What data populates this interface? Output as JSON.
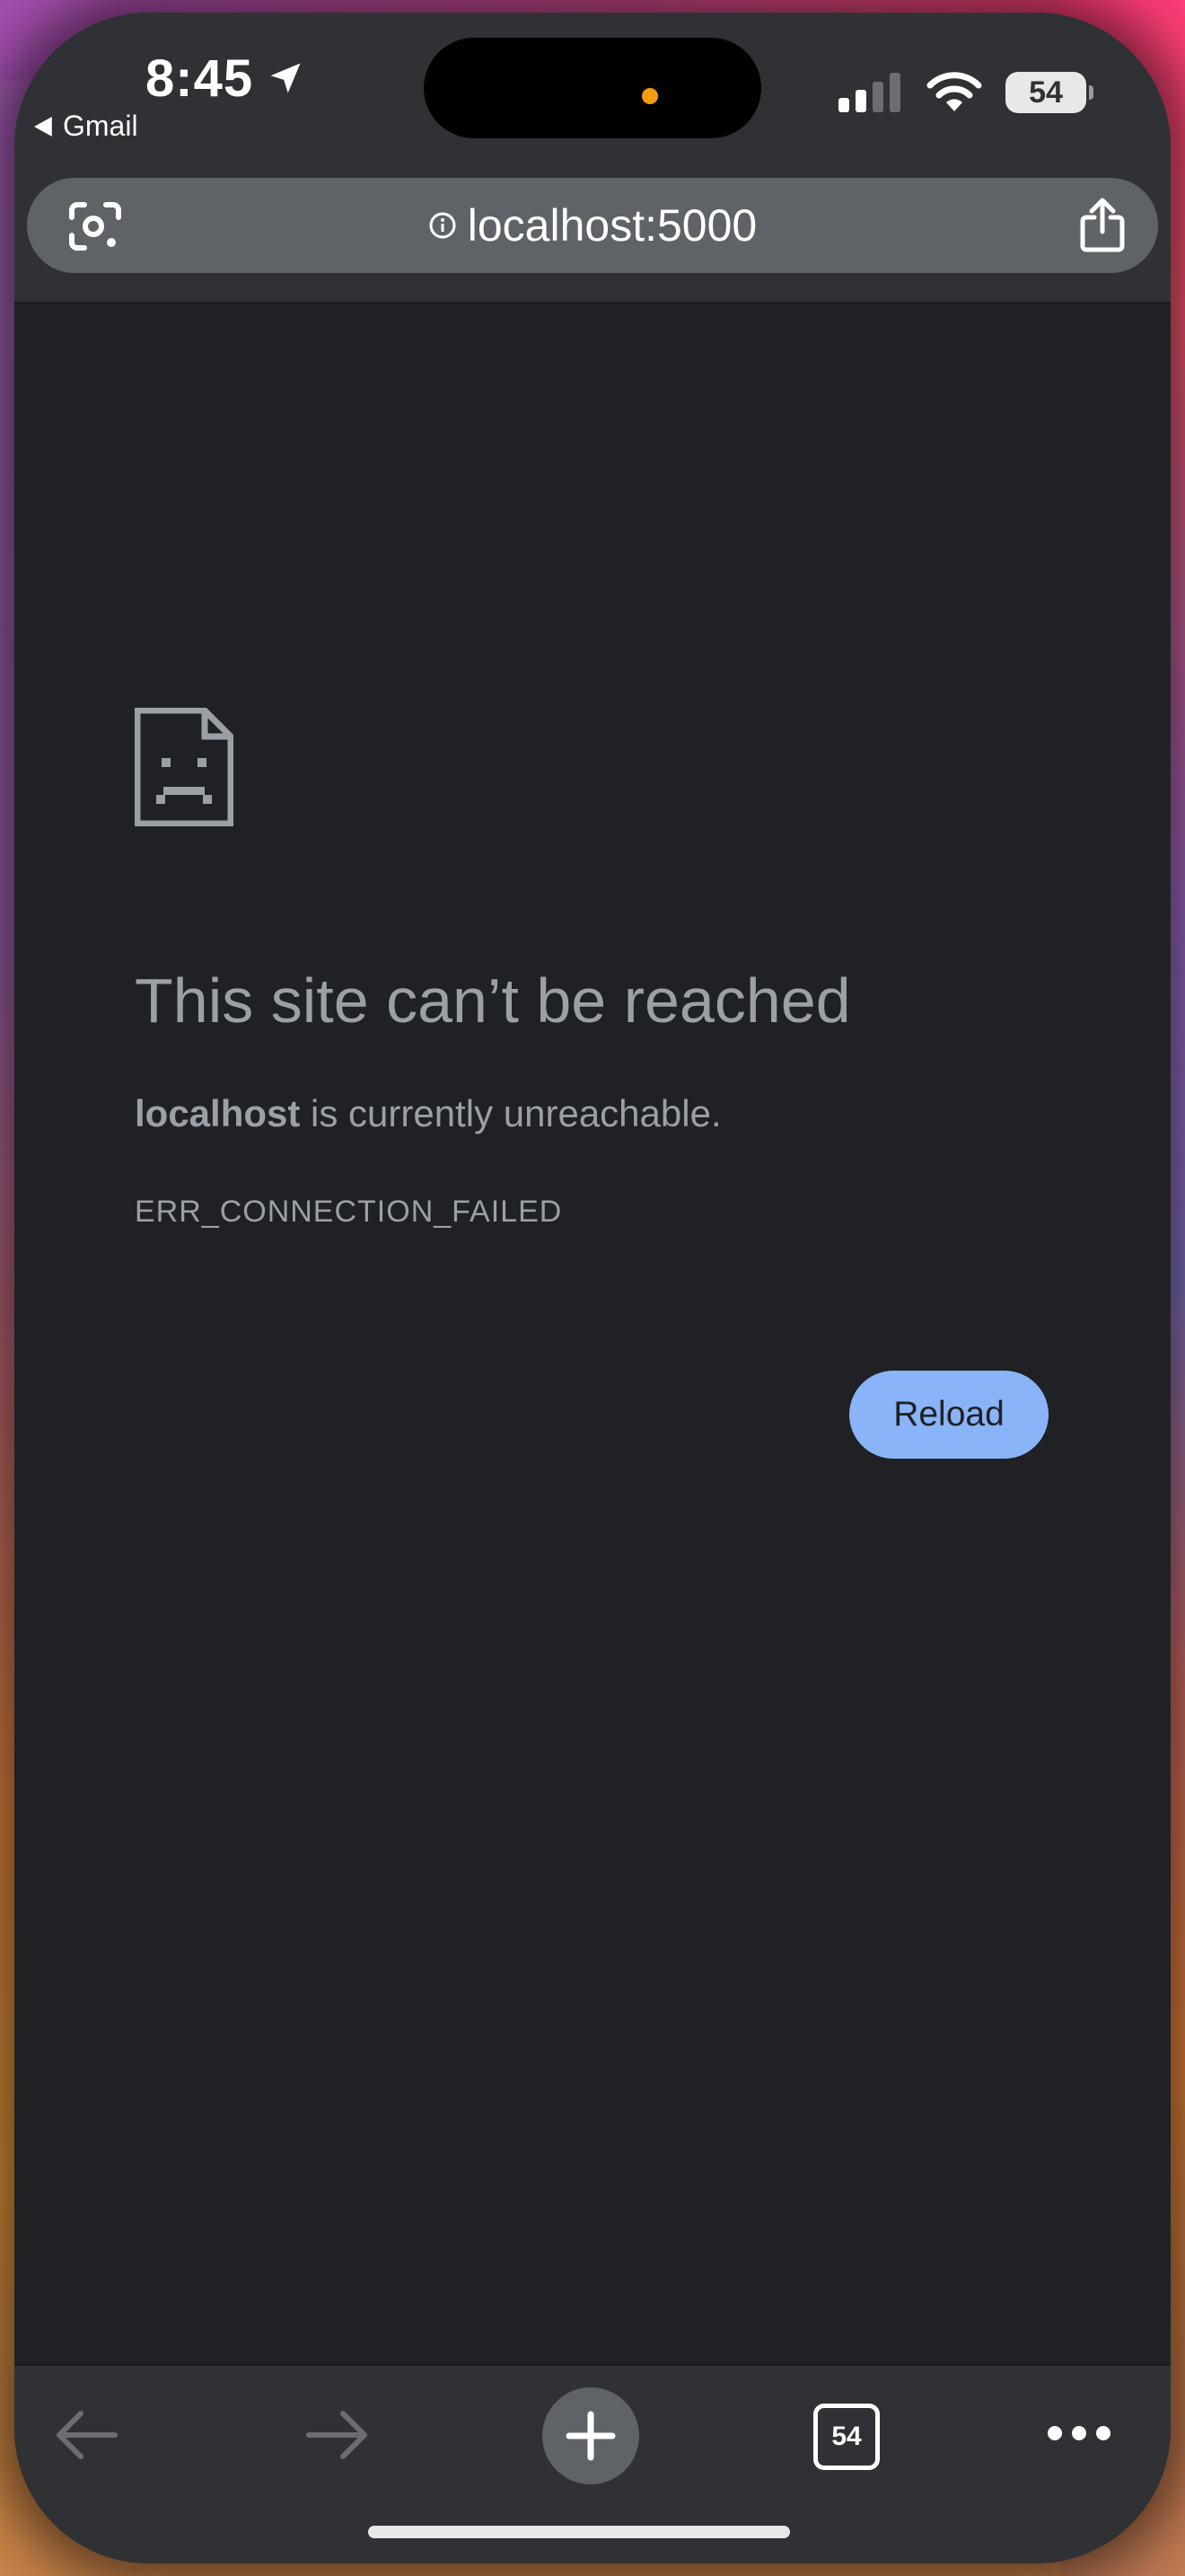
{
  "status_bar": {
    "time": "8:45",
    "back_app_label": "Gmail",
    "battery_level": "54",
    "icons": [
      "location-arrow-icon",
      "cellular-signal-icon",
      "wifi-icon",
      "battery-icon"
    ]
  },
  "address_bar": {
    "url": "localhost:5000",
    "left_icon": "lens-search-icon",
    "info_icon": "info-icon",
    "right_icon": "share-icon"
  },
  "error_page": {
    "icon": "sad-page-icon",
    "title": "This site can’t be reached",
    "description_bold": "localhost",
    "description_rest": " is currently unreachable.",
    "error_code": "ERR_CONNECTION_FAILED",
    "reload_label": "Reload"
  },
  "toolbar": {
    "tab_count": "54",
    "icons": [
      "back-arrow-icon",
      "forward-arrow-icon",
      "new-tab-plus-icon",
      "tab-switcher-icon",
      "more-options-icon"
    ]
  },
  "colors": {
    "page_background": "#202124",
    "chrome_background": "#303134",
    "url_pill": "#5f6368",
    "text_muted": "#9aa0a6",
    "reload_button": "#8ab4f8",
    "recording_dot": "#f39c12"
  }
}
